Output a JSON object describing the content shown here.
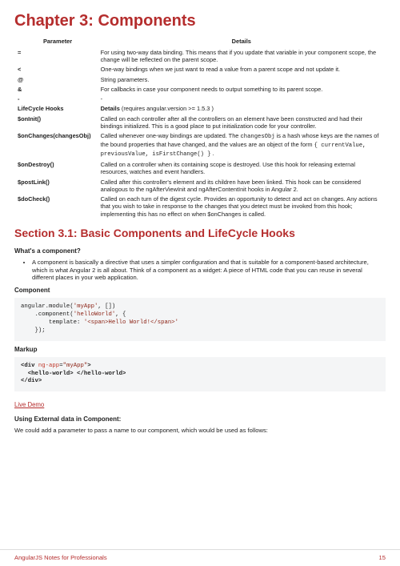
{
  "chapterTitle": "Chapter 3: Components",
  "tableHeaders": {
    "param": "Parameter",
    "details": "Details"
  },
  "rows": [
    {
      "p": "=",
      "d": "For using two-way data binding. This means that if you update that variable in your component scope, the change will be reflected on the parent scope."
    },
    {
      "p": "<",
      "d": "One-way bindings when we just want to read a value from a parent scope and not update it."
    },
    {
      "p": "@",
      "d": "String parameters."
    },
    {
      "p": "&",
      "d": "For callbacks in case your component needs to output something to its parent scope."
    },
    {
      "p": "-",
      "d": "-"
    },
    {
      "p": "LifeCycle Hooks",
      "d_prefix": "Details ",
      "d_suffix": "(requires angular.version >= 1.5.3 )"
    },
    {
      "p": "$onInit()",
      "d": "Called on each controller after all the controllers on an element have been constructed and had their bindings initialized. This is a good place to put initialization code for your controller."
    },
    {
      "p": "$onChanges(changesObj)",
      "d_pre": "Called whenever one-way bindings are updated. The ",
      "d_code1": "changesObj",
      "d_mid1": " is a hash whose keys are the names of the bound properties that have changed, and the values are an object of the form ",
      "d_code2": "{ currentValue, previousValue, isFirstChange() }",
      "d_post": " ."
    },
    {
      "p": "$onDestroy()",
      "d": "Called on a controller when its containing scope is destroyed. Use this hook for releasing external resources, watches and event handlers."
    },
    {
      "p": "$postLink()",
      "d": "Called after this controller's element and its children have been linked. This hook can be considered analogous to the ngAfterViewInit and ngAfterContentInit hooks in Angular 2."
    },
    {
      "p": "$doCheck()",
      "d": "Called on each turn of the digest cycle. Provides an opportunity to detect and act on changes. Any actions that you wish to take in response to the changes that you detect must be invoked from this hook; implementing this has no effect on when $onChanges is called."
    }
  ],
  "sectionTitle": "Section 3.1: Basic Components and LifeCycle Hooks",
  "q1": "What's a component?",
  "bullet1": "A component is basically a directive that uses a simpler configuration and that is suitable for a component-based architecture, which is what Angular 2 is all about. Think of a component as a widget: A piece of HTML code that you can reuse in several different places in your web application.",
  "hComponent": "Component",
  "code1": {
    "l1a": "angular.",
    "l1b": "module",
    "l1c": "(",
    "l1d": "'myApp'",
    "l1e": ", [])",
    "l2a": "    .",
    "l2b": "component",
    "l2c": "(",
    "l2d": "'helloWorld'",
    "l2e": ", {",
    "l3a": "        template:",
    "l3b": " '<span>Hello World!</span>'",
    "l4": "    });"
  },
  "hMarkup": "Markup",
  "code2": {
    "l1a": "<div ",
    "l1b": "ng-app",
    "l1c": "=",
    "l1d": "\"myApp\"",
    "l1e": ">",
    "l2": "  <hello-world> </hello-world>",
    "l3": "</div>"
  },
  "liveDemo": "Live Demo",
  "hExternal": "Using External data in Component:",
  "pExternal": "We could add a parameter to pass a name to our component, which would be used as follows:",
  "footerLeft": "AngularJS Notes for Professionals",
  "footerRight": "15"
}
